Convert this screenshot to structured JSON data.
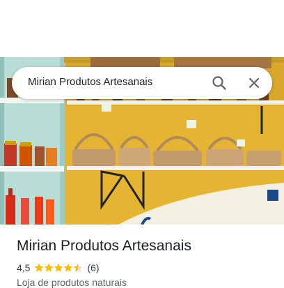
{
  "search": {
    "query": "Mirian Produtos Artesanais",
    "search_icon": "search-icon",
    "clear_icon": "close-icon"
  },
  "place": {
    "name": "Mirian Produtos Artesanais",
    "rating_text": "4,5",
    "rating_value": 4.5,
    "review_count": "(6)",
    "category": "Loja de produtos naturais"
  },
  "colors": {
    "star": "#fbbc04",
    "star_empty": "#dadce0",
    "wall": "#e3b230",
    "shelf_frame": "#a9d5cd"
  }
}
